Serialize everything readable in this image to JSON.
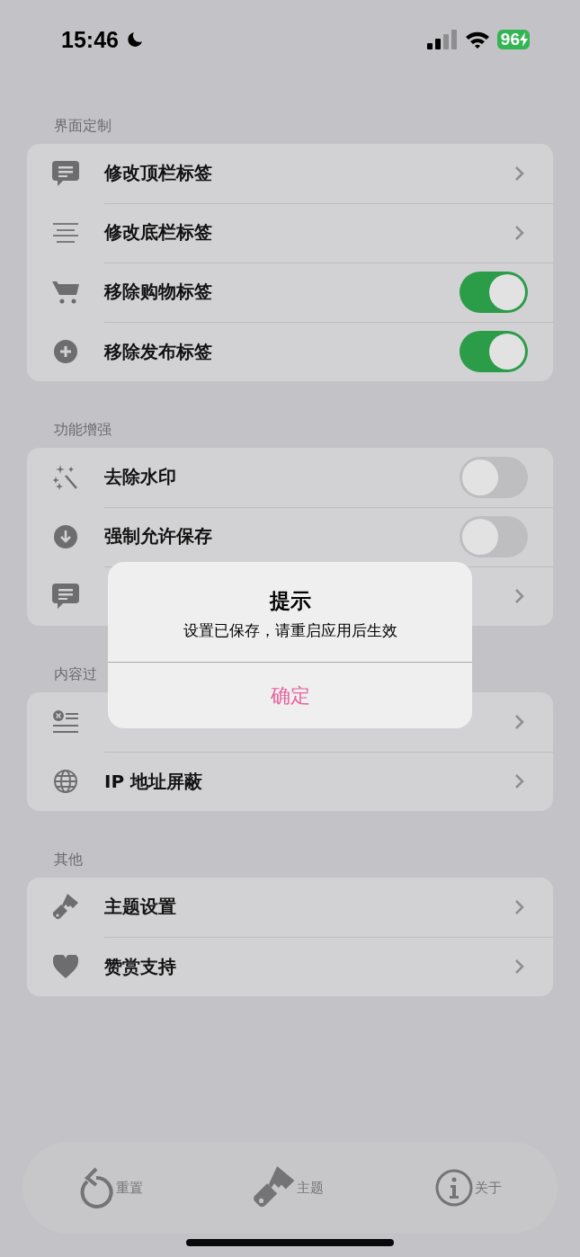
{
  "status_bar": {
    "time": "15:46",
    "battery": "96"
  },
  "sections": [
    {
      "header": "界面定制",
      "rows": [
        {
          "kind": "link",
          "label": "修改顶栏标签"
        },
        {
          "kind": "link",
          "label": "修改底栏标签"
        },
        {
          "kind": "toggle",
          "label": "移除购物标签",
          "on": true
        },
        {
          "kind": "toggle",
          "label": "移除发布标签",
          "on": true
        }
      ]
    },
    {
      "header": "功能增强",
      "rows": [
        {
          "kind": "toggle",
          "label": "去除水印",
          "on": false
        },
        {
          "kind": "toggle",
          "label": "强制允许保存",
          "on": false
        },
        {
          "kind": "link"
        }
      ]
    },
    {
      "header": "内容过",
      "rows": [
        {
          "kind": "link"
        },
        {
          "kind": "link",
          "label": "IP 地址屏蔽"
        }
      ]
    },
    {
      "header": "其他",
      "rows": [
        {
          "kind": "link",
          "label": "主题设置"
        },
        {
          "kind": "link",
          "label": "赞赏支持"
        }
      ]
    }
  ],
  "dialog": {
    "title": "提示",
    "message": "设置已保存，请重启应用后生效",
    "button": "确定"
  },
  "tab_bar": [
    {
      "label": "重置"
    },
    {
      "label": "主题"
    },
    {
      "label": "关于"
    }
  ]
}
